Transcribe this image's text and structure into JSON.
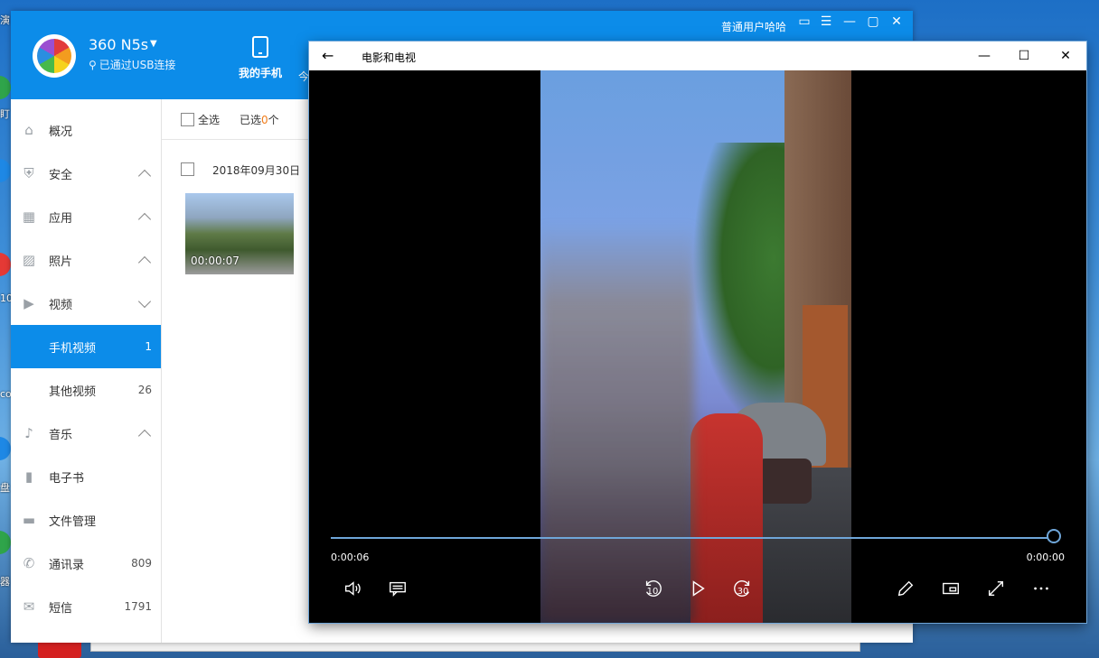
{
  "desktop": {
    "glyphs": [
      "演",
      "盯",
      "10",
      "co",
      "盘",
      "盘",
      "器"
    ]
  },
  "phone_manager": {
    "device_name": "360 N5s",
    "usb_status": "已通过USB连接",
    "tab_myphone": "我的手机",
    "tab_next": "今",
    "user_label": "普通用户哈哈",
    "sidebar": [
      {
        "label": "概况",
        "icon": "home-icon",
        "extra": ""
      },
      {
        "label": "安全",
        "icon": "shield-icon",
        "extra": "chevron-up"
      },
      {
        "label": "应用",
        "icon": "apps-grid-icon",
        "extra": "chevron-up"
      },
      {
        "label": "照片",
        "icon": "image-icon",
        "extra": "chevron-up"
      },
      {
        "label": "视频",
        "icon": "video-play-icon",
        "extra": "chevron-down"
      },
      {
        "label": "手机视频",
        "icon": "",
        "extra": "1",
        "active": true
      },
      {
        "label": "其他视频",
        "icon": "",
        "extra": "26"
      },
      {
        "label": "音乐",
        "icon": "music-note-icon",
        "extra": "chevron-up"
      },
      {
        "label": "电子书",
        "icon": "book-icon",
        "extra": ""
      },
      {
        "label": "文件管理",
        "icon": "folder-icon",
        "extra": ""
      },
      {
        "label": "通讯录",
        "icon": "phone-call-icon",
        "extra": "809"
      },
      {
        "label": "短信",
        "icon": "sms-icon",
        "extra": "1791"
      }
    ],
    "toolbar": {
      "select_all": "全选",
      "selected_prefix": "已选",
      "selected_count": "0",
      "selected_suffix": "个"
    },
    "date_group": "2018年09月30日",
    "video_thumb_duration": "00:00:07",
    "accent_color": "#0c8ce9"
  },
  "player": {
    "title": "电影和电视",
    "elapsed": "0:00:06",
    "remaining": "0:00:00",
    "progress": 1.0,
    "skip_back_label": "10",
    "skip_forward_label": "30",
    "accent_color": "#6fa6d9"
  }
}
